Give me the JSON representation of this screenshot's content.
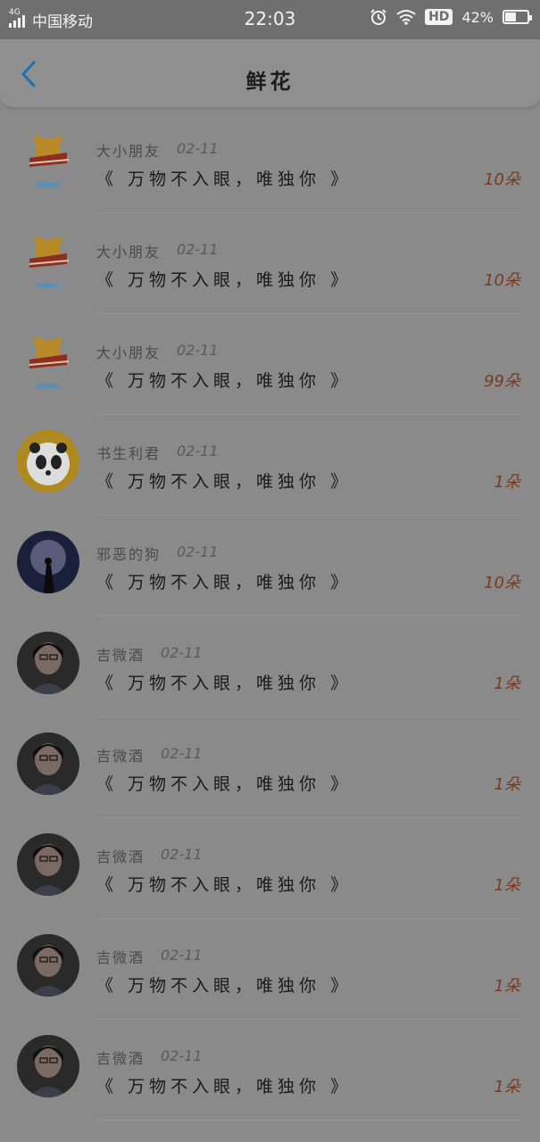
{
  "status_bar": {
    "network": "4G",
    "carrier": "中国移动",
    "time": "22:03",
    "hd": "HD",
    "battery": "42%"
  },
  "nav": {
    "title": "鲜花"
  },
  "items": [
    {
      "name": "大小朋友",
      "date": "02-11",
      "message": "《 万物不入眼，唯独你 》",
      "count": "10朵",
      "avatar": "pooh-bear"
    },
    {
      "name": "大小朋友",
      "date": "02-11",
      "message": "《 万物不入眼，唯独你 》",
      "count": "10朵",
      "avatar": "pooh-bear"
    },
    {
      "name": "大小朋友",
      "date": "02-11",
      "message": "《 万物不入眼，唯独你 》",
      "count": "99朵",
      "avatar": "pooh-bear"
    },
    {
      "name": "书生利君",
      "date": "02-11",
      "message": "《 万物不入眼，唯独你 》",
      "count": "1朵",
      "avatar": "panda-sun"
    },
    {
      "name": "邪恶的狗",
      "date": "02-11",
      "message": "《 万物不入眼，唯独你 》",
      "count": "10朵",
      "avatar": "moon-warrior"
    },
    {
      "name": "吉微酒",
      "date": "02-11",
      "message": "《 万物不入眼，唯独你 》",
      "count": "1朵",
      "avatar": "girl-portrait"
    },
    {
      "name": "吉微酒",
      "date": "02-11",
      "message": "《 万物不入眼，唯独你 》",
      "count": "1朵",
      "avatar": "girl-portrait"
    },
    {
      "name": "吉微酒",
      "date": "02-11",
      "message": "《 万物不入眼，唯独你 》",
      "count": "1朵",
      "avatar": "girl-portrait"
    },
    {
      "name": "吉微酒",
      "date": "02-11",
      "message": "《 万物不入眼，唯独你 》",
      "count": "1朵",
      "avatar": "girl-portrait"
    },
    {
      "name": "吉微酒",
      "date": "02-11",
      "message": "《 万物不入眼，唯独你 》",
      "count": "1朵",
      "avatar": "girl-portrait"
    }
  ],
  "colors": {
    "accent": "#1e6fb4",
    "count": "#7a3a22"
  }
}
